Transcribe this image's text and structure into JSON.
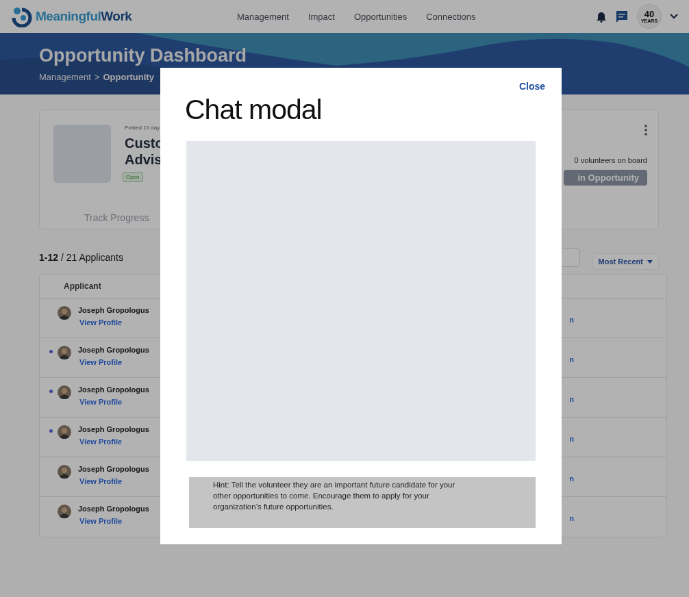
{
  "header": {
    "logo": {
      "first": "Meaningful",
      "second": "Work"
    },
    "nav": [
      {
        "label": "Management"
      },
      {
        "label": "Impact"
      },
      {
        "label": "Opportunities"
      },
      {
        "label": "Connections"
      }
    ],
    "badge": {
      "number": "40",
      "caption": "YEARS"
    }
  },
  "banner": {
    "title": "Opportunity Dashboard",
    "separator": ">",
    "breadcrumb": [
      {
        "label": "Management",
        "current": false
      },
      {
        "label": "Opportunity",
        "current": true
      }
    ]
  },
  "opportunity_card": {
    "posted": "Posted 10 day",
    "title_lines": [
      "Custo",
      "Advis"
    ],
    "status": "Open",
    "track_link": "Track Progress",
    "volunteers": "0 volunteers on board",
    "action": "in Opportunity"
  },
  "applicants": {
    "count": "**1-12** / 21 Applicants",
    "sort": "Most Recent",
    "columns": [
      "Applicant"
    ],
    "rows": [
      {
        "name": "Joseph Gropologus",
        "link": "View Profile",
        "unread": false,
        "column_2": "n"
      },
      {
        "name": "Joseph Gropologus",
        "link": "View Profile",
        "unread": true,
        "column_2": "n"
      },
      {
        "name": "Joseph Gropologus",
        "link": "View Profile",
        "unread": true,
        "column_2": "n"
      },
      {
        "name": "Joseph Gropologus",
        "link": "View Profile",
        "unread": true,
        "column_2": "n"
      },
      {
        "name": "Joseph Gropologus",
        "link": "View Profile",
        "unread": false,
        "column_2": "n"
      },
      {
        "name": "Joseph Gropologus",
        "link": "View Profile",
        "unread": false,
        "column_2": "n"
      }
    ]
  },
  "modal": {
    "title": "Chat modal",
    "close": "Close",
    "hint": "Hint: Tell the volunteer they are an important future candidate for your other opportunities to come. Encourage them to apply for your organization’s future opportunities."
  }
}
